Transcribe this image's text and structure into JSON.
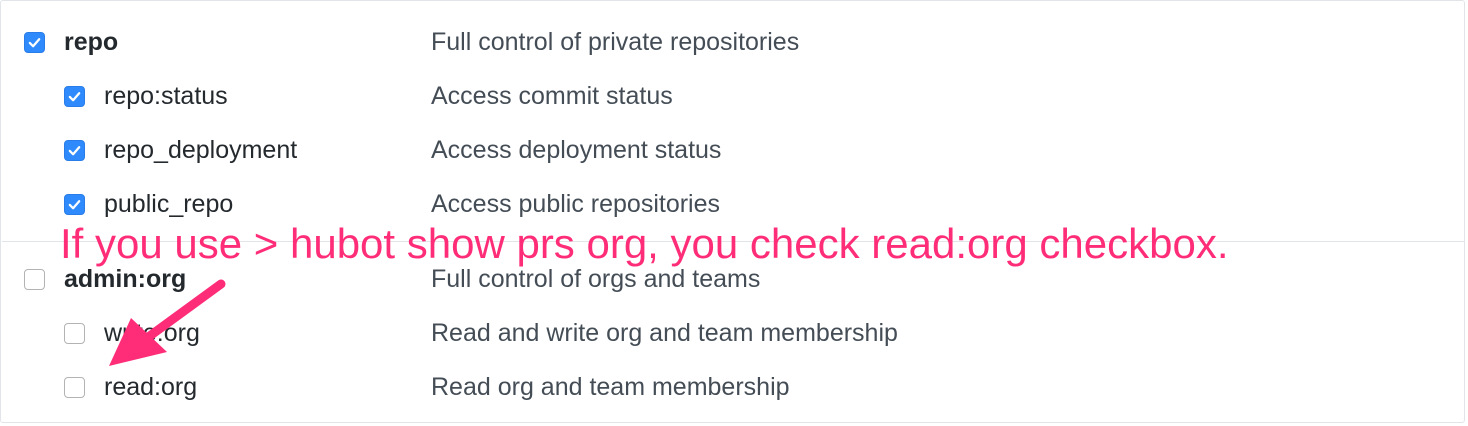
{
  "scopes": [
    {
      "name": "repo",
      "description": "Full control of private repositories",
      "checked": true,
      "parent": true
    },
    {
      "name": "repo:status",
      "description": "Access commit status",
      "checked": true,
      "parent": false
    },
    {
      "name": "repo_deployment",
      "description": "Access deployment status",
      "checked": true,
      "parent": false
    },
    {
      "name": "public_repo",
      "description": "Access public repositories",
      "checked": true,
      "parent": false
    },
    {
      "name": "admin:org",
      "description": "Full control of orgs and teams",
      "checked": false,
      "parent": true
    },
    {
      "name": "write:org",
      "description": "Read and write org and team membership",
      "checked": false,
      "parent": false
    },
    {
      "name": "read:org",
      "description": "Read org and team membership",
      "checked": false,
      "parent": false
    }
  ],
  "annotation": {
    "text": "If you use > hubot show prs org, you check read:org checkbox.",
    "color": "#ff2d78"
  },
  "colors": {
    "checkbox_checked": "#2f8bfd",
    "text": "#24292e",
    "description": "#444d56"
  }
}
